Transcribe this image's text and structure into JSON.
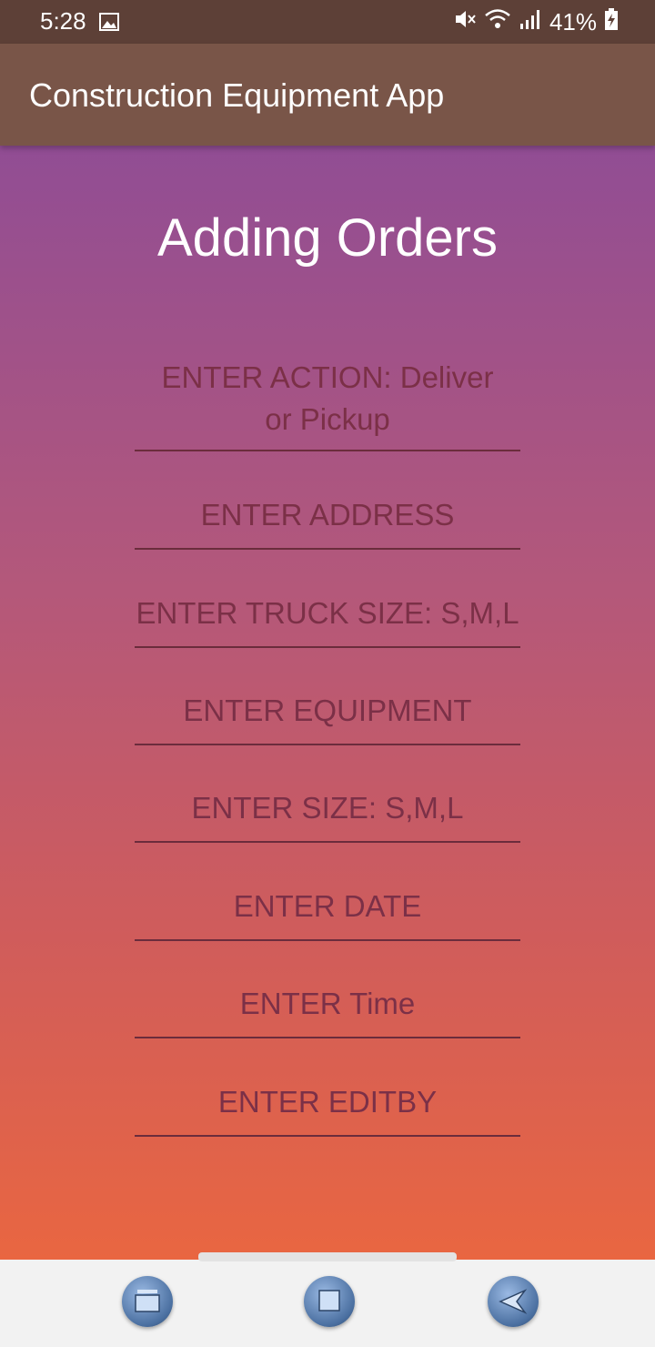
{
  "status_bar": {
    "time": "5:28",
    "battery": "41%"
  },
  "app_bar": {
    "title": "Construction Equipment App"
  },
  "page": {
    "heading": "Adding Orders"
  },
  "form": {
    "fields": [
      {
        "placeholder": "ENTER ACTION: Deliver or Pickup"
      },
      {
        "placeholder": "ENTER ADDRESS"
      },
      {
        "placeholder": "ENTER TRUCK SIZE: S,M,L"
      },
      {
        "placeholder": "ENTER EQUIPMENT"
      },
      {
        "placeholder": "ENTER SIZE: S,M,L"
      },
      {
        "placeholder": "ENTER DATE"
      },
      {
        "placeholder": "ENTER Time"
      },
      {
        "placeholder": "ENTER EDITBY"
      }
    ]
  },
  "colors": {
    "status_bar": "#5d4037",
    "app_bar": "#795548",
    "gradient_top": "#914d94",
    "gradient_bottom": "#e96641",
    "placeholder_text": "#7b3047"
  },
  "icons": {
    "status": [
      "image-icon",
      "mute-icon",
      "wifi-icon",
      "signal-icon",
      "battery-charging-icon"
    ],
    "nav": [
      "recent-apps-icon",
      "home-icon",
      "back-icon"
    ]
  }
}
